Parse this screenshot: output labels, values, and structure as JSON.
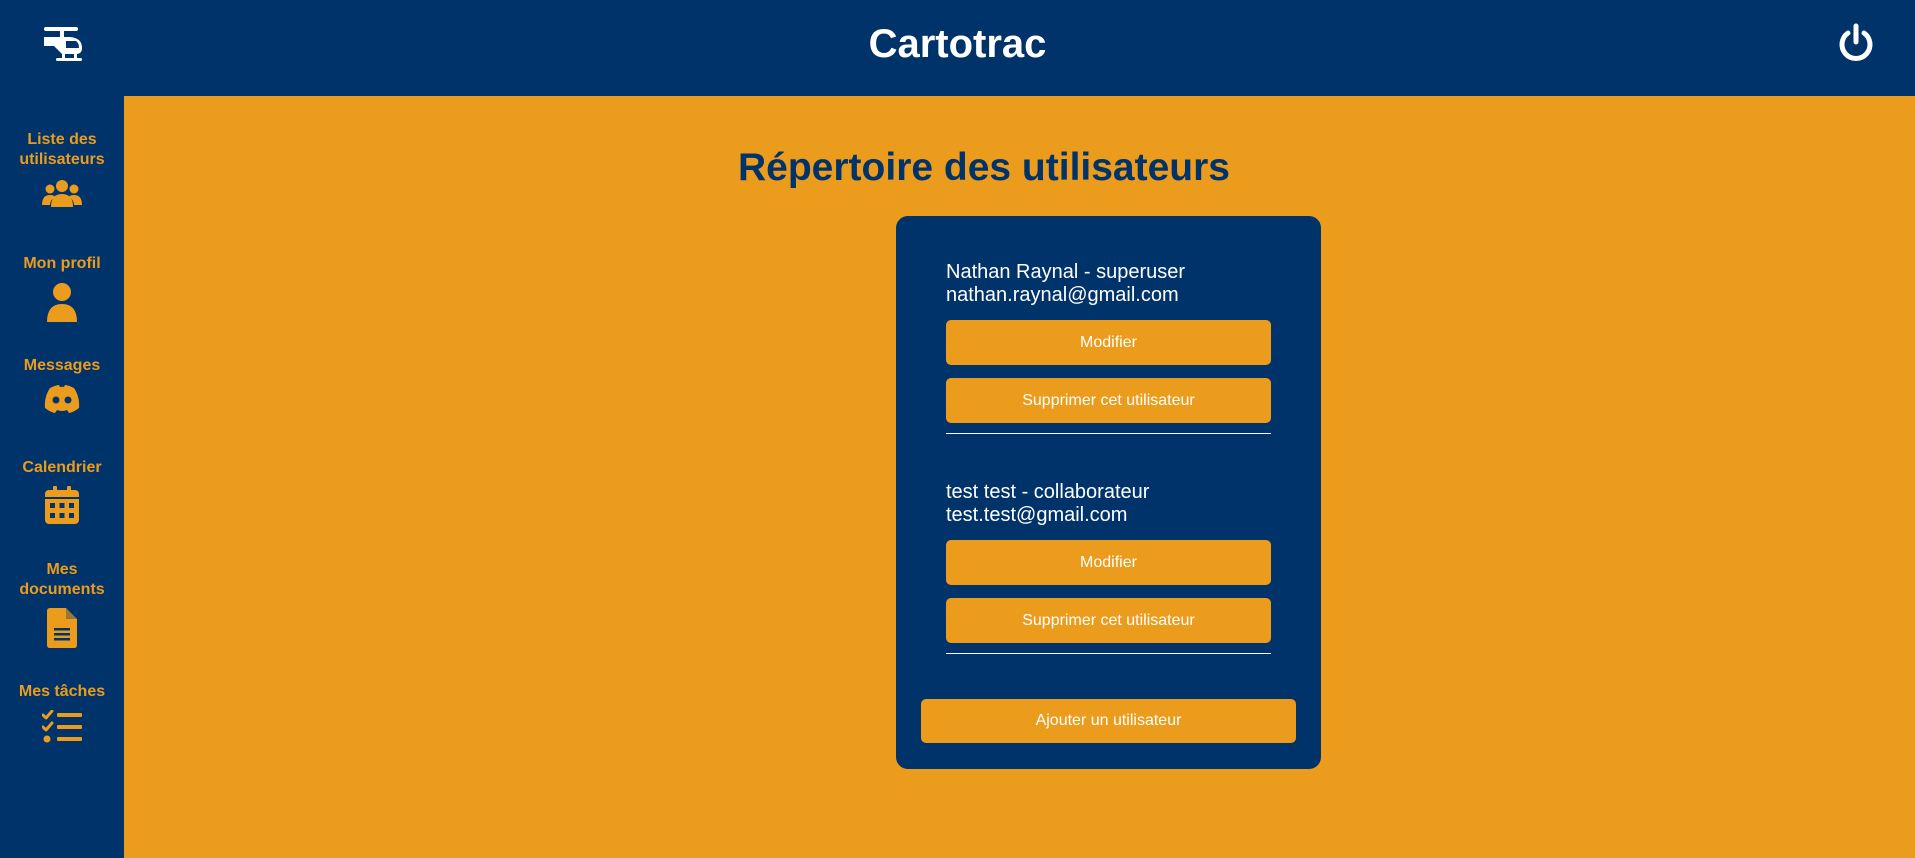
{
  "app": {
    "title": "Cartotrac",
    "logo_icon": "helicopter-icon",
    "power_icon": "power-icon"
  },
  "colors": {
    "primary": "#00336a",
    "accent": "#ec9c1c",
    "text_light": "#ffffff"
  },
  "sidebar": {
    "items": [
      {
        "label": "Liste des utilisateurs",
        "icon": "users-icon"
      },
      {
        "label": "Mon profil",
        "icon": "user-icon"
      },
      {
        "label": "Messages",
        "icon": "discord-icon"
      },
      {
        "label": "Calendrier",
        "icon": "calendar-icon"
      },
      {
        "label": "Mes documents",
        "icon": "document-icon"
      },
      {
        "label": "Mes tâches",
        "icon": "task-list-icon"
      }
    ]
  },
  "main": {
    "title": "Répertoire des utilisateurs",
    "users": [
      {
        "name_role": "Nathan Raynal - superuser",
        "email": "nathan.raynal@gmail.com",
        "edit_label": "Modifier",
        "delete_label": "Supprimer cet utilisateur"
      },
      {
        "name_role": "test test - collaborateur",
        "email": "test.test@gmail.com",
        "edit_label": "Modifier",
        "delete_label": "Supprimer cet utilisateur"
      }
    ],
    "add_label": "Ajouter un utilisateur"
  }
}
